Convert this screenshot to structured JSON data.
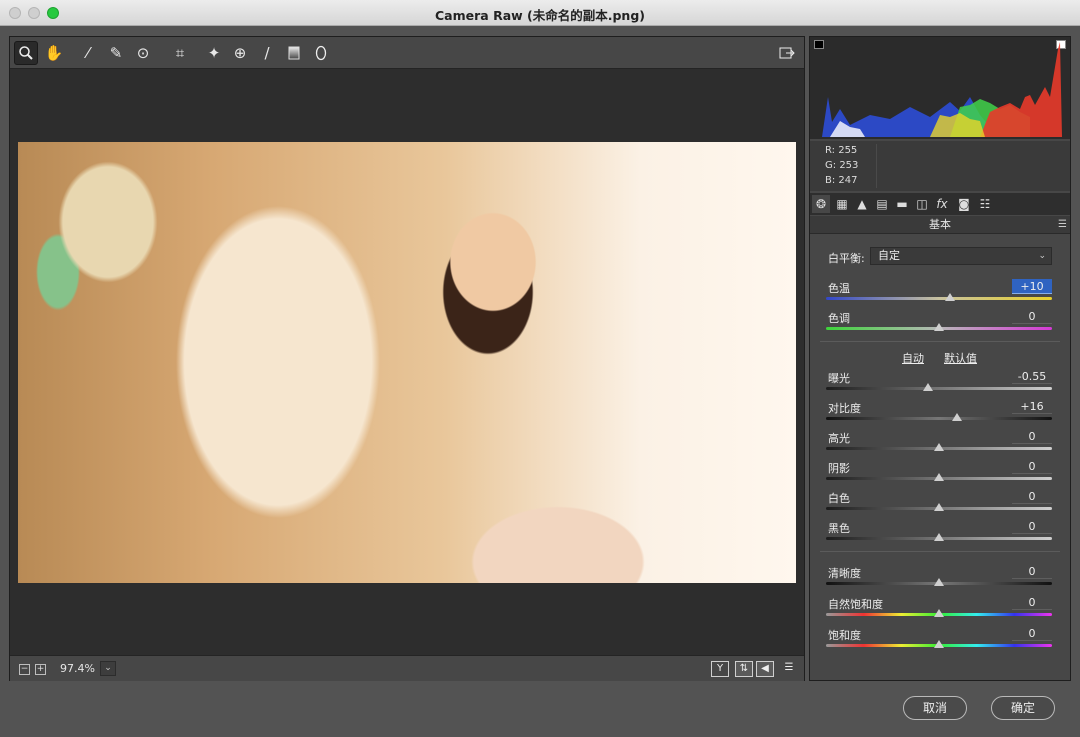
{
  "window": {
    "title": "Camera Raw (未命名的副本.png)"
  },
  "toolbar": {
    "tools": [
      "zoom-icon",
      "hand-icon",
      "eyedropper-icon",
      "color-sampler-icon",
      "targeted-adjust-icon",
      "crop-icon",
      "straighten-icon",
      "red-eye-icon",
      "brush-icon",
      "gradient-icon",
      "radial-filter-icon"
    ],
    "export_icon": "open-export-icon"
  },
  "status": {
    "zoom": "97.4%",
    "y_button": "Y",
    "zoom_out": "−",
    "zoom_in": "+"
  },
  "histogram": {
    "r_label": "R:",
    "r": "255",
    "g_label": "G:",
    "g": "253",
    "b_label": "B:",
    "b": "247"
  },
  "panel": {
    "title": "基本",
    "white_balance": {
      "label": "白平衡:",
      "value": "自定"
    },
    "auto": "自动",
    "default": "默认值",
    "sliders": [
      {
        "label": "色温",
        "value": "+10",
        "pos": 0.55,
        "track": "temp"
      },
      {
        "label": "色调",
        "value": "0",
        "pos": 0.5,
        "track": "tint"
      },
      {
        "label": "曝光",
        "value": "-0.55",
        "pos": 0.45,
        "track": "gray"
      },
      {
        "label": "对比度",
        "value": "+16",
        "pos": 0.58,
        "track": "dark"
      },
      {
        "label": "高光",
        "value": "0",
        "pos": 0.5,
        "track": "gray"
      },
      {
        "label": "阴影",
        "value": "0",
        "pos": 0.5,
        "track": "gray"
      },
      {
        "label": "白色",
        "value": "0",
        "pos": 0.5,
        "track": "gray"
      },
      {
        "label": "黑色",
        "value": "0",
        "pos": 0.5,
        "track": "gray"
      },
      {
        "label": "清晰度",
        "value": "0",
        "pos": 0.5,
        "track": "dark"
      },
      {
        "label": "自然饱和度",
        "value": "0",
        "pos": 0.5,
        "track": "sat"
      },
      {
        "label": "饱和度",
        "value": "0",
        "pos": 0.5,
        "track": "sat"
      }
    ]
  },
  "buttons": {
    "cancel": "取消",
    "ok": "确定"
  }
}
